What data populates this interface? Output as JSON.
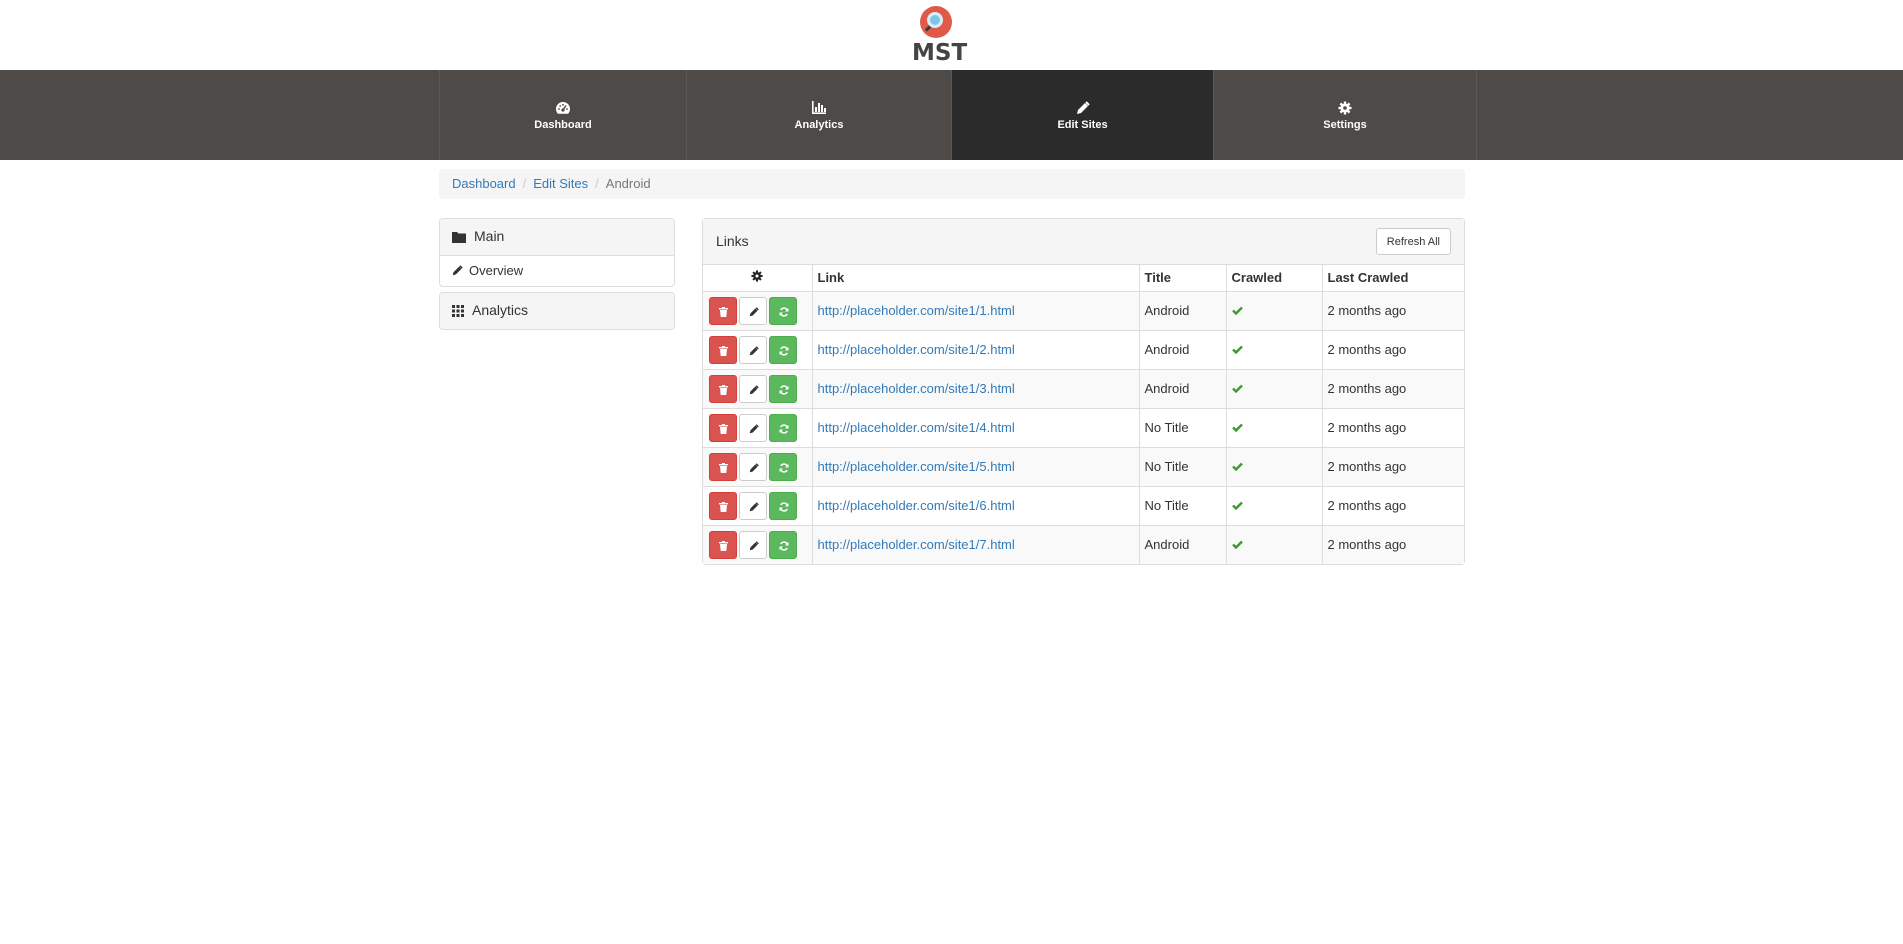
{
  "brand": {
    "logo_text": "MST"
  },
  "nav": {
    "items": [
      {
        "label": "Dashboard",
        "icon": "dashboard-icon",
        "active": false
      },
      {
        "label": "Analytics",
        "icon": "bar-chart-icon",
        "active": false
      },
      {
        "label": "Edit Sites",
        "icon": "pencil-icon",
        "active": true
      },
      {
        "label": "Settings",
        "icon": "gear-icon",
        "active": false
      }
    ]
  },
  "breadcrumb": {
    "items": [
      "Dashboard",
      "Edit Sites"
    ],
    "current": "Android"
  },
  "sidebar": {
    "main_title": "Main",
    "overview_label": "Overview",
    "analytics_title": "Analytics"
  },
  "links_panel": {
    "title": "Links",
    "refresh_all_label": "Refresh All",
    "columns": {
      "link": "Link",
      "title": "Title",
      "crawled": "Crawled",
      "last_crawled": "Last Crawled"
    },
    "rows": [
      {
        "link": "http://placeholder.com/site1/1.html",
        "title": "Android",
        "crawled": true,
        "last_crawled": "2 months ago"
      },
      {
        "link": "http://placeholder.com/site1/2.html",
        "title": "Android",
        "crawled": true,
        "last_crawled": "2 months ago"
      },
      {
        "link": "http://placeholder.com/site1/3.html",
        "title": "Android",
        "crawled": true,
        "last_crawled": "2 months ago"
      },
      {
        "link": "http://placeholder.com/site1/4.html",
        "title": "No Title",
        "crawled": true,
        "last_crawled": "2 months ago"
      },
      {
        "link": "http://placeholder.com/site1/5.html",
        "title": "No Title",
        "crawled": true,
        "last_crawled": "2 months ago"
      },
      {
        "link": "http://placeholder.com/site1/6.html",
        "title": "No Title",
        "crawled": true,
        "last_crawled": "2 months ago"
      },
      {
        "link": "http://placeholder.com/site1/7.html",
        "title": "Android",
        "crawled": true,
        "last_crawled": "2 months ago"
      }
    ]
  },
  "colors": {
    "nav_bg": "#4e4a48",
    "nav_active_bg": "#2b2b2b",
    "link": "#337ab7",
    "danger": "#d9534f",
    "success": "#5cb85c",
    "check": "#3c9a2f"
  }
}
